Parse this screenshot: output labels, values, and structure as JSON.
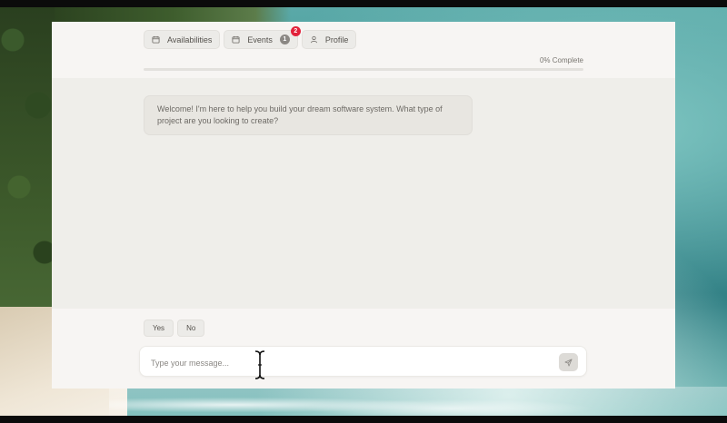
{
  "tabs": [
    {
      "label": "Availabilities",
      "icon": "calendar-icon"
    },
    {
      "label": "Events",
      "icon": "calendar-icon",
      "count": "1",
      "notifications": "2"
    },
    {
      "label": "Profile",
      "icon": "user-icon"
    }
  ],
  "progress": {
    "label": "0% Complete",
    "percent": 0
  },
  "chat": {
    "messages": [
      {
        "role": "assistant",
        "text": "Welcome! I'm here to help you build your dream software system. What type of project are you looking to create?"
      }
    ]
  },
  "quick_replies": [
    "Yes",
    "No"
  ],
  "composer": {
    "placeholder": "Type your message...",
    "value": "",
    "send_icon": "send-icon"
  },
  "colors": {
    "notification_badge": "#e2223b",
    "background": "#f7f5f3",
    "chat_area": "#efeeea"
  }
}
